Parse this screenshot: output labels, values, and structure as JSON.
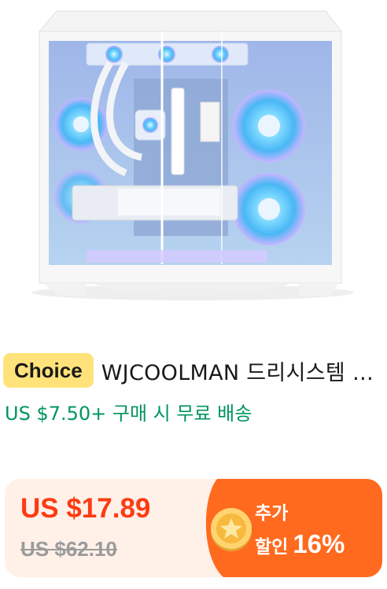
{
  "product": {
    "badge": "Choice",
    "title": "WJCOOLMAN 드리시스템 케이스",
    "shipping": "US $7.50+ 구매 시 무료 배송"
  },
  "price": {
    "current": "US $17.89",
    "original": "US $62.10",
    "extra_label": "추가",
    "discount_label": "할인",
    "discount_value": "16%"
  },
  "icons": {
    "coin": "coin-star-icon",
    "product": "pc-case-product-image"
  },
  "colors": {
    "badge_bg": "#ffe37a",
    "shipping_green": "#00955d",
    "price_red": "#fd3b12",
    "discount_orange": "#ff6a1f"
  }
}
